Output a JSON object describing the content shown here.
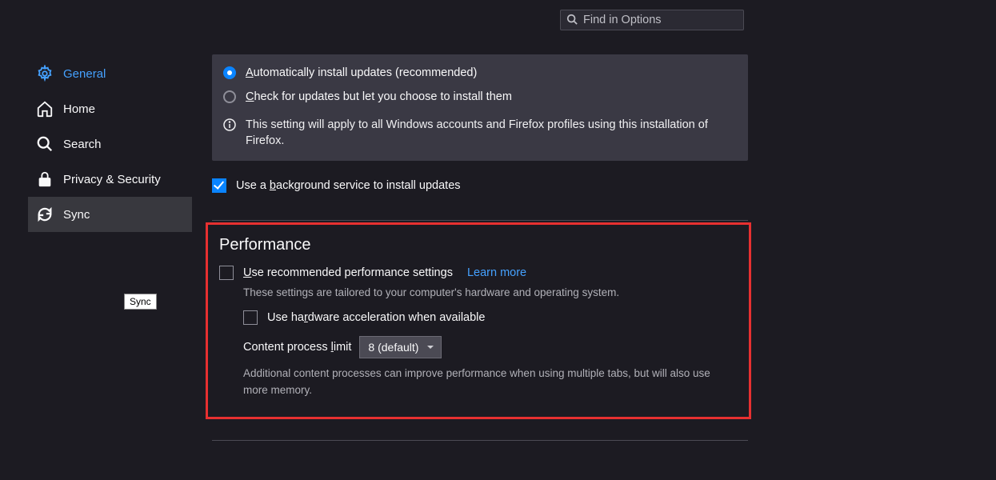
{
  "search": {
    "placeholder": "Find in Options"
  },
  "sidebar": {
    "items": [
      {
        "label": "General"
      },
      {
        "label": "Home"
      },
      {
        "label": "Search"
      },
      {
        "label": "Privacy & Security"
      },
      {
        "label": "Sync"
      }
    ],
    "tooltip": "Sync"
  },
  "updates": {
    "radio_auto": "utomatically install updates (recommended)",
    "radio_check": "heck for updates but let you choose to install them",
    "info_note": "This setting will apply to all Windows accounts and Firefox profiles using this installation of Firefox.",
    "bg_service_prefix": "Use a ",
    "bg_service_suffix": "ackground service to install updates"
  },
  "performance": {
    "heading": "Performance",
    "use_recommended_suffix": "se recommended performance settings",
    "learn_more": "Learn more",
    "helper1": "These settings are tailored to your computer's hardware and operating system.",
    "hw_accel_prefix": "Use ha",
    "hw_accel_suffix": "dware acceleration when available",
    "process_limit_prefix": "Content process ",
    "process_limit_suffix": "imit",
    "process_limit_value": "8 (default)",
    "helper2": "Additional content processes can improve performance when using multiple tabs, but will also use more memory."
  }
}
